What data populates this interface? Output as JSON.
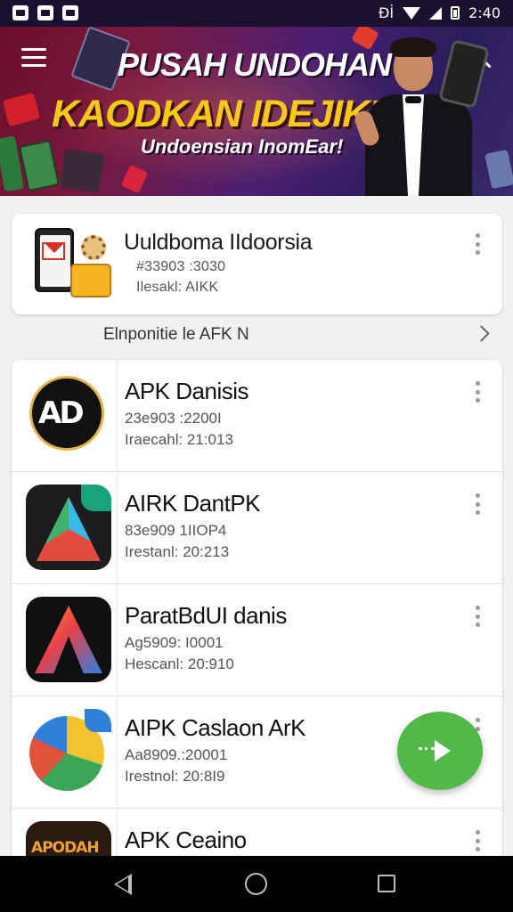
{
  "status_bar": {
    "time": "2:40",
    "left_icons": [
      "notification-icon",
      "notification-icon",
      "notification-icon"
    ],
    "right_icons": [
      "vibrate-icon",
      "wifi-icon",
      "signal-icon",
      "battery-icon"
    ],
    "vibrate_glyph": "Đİ"
  },
  "banner": {
    "line1": "PUSAH UNDOHAN",
    "line2": "KAODKAN IDEJIK'S",
    "line3": "Undoensian InomEar!",
    "colors": {
      "title": "#ffffff",
      "highlight": "#f7c916",
      "background": "#4c1e72"
    }
  },
  "toolbar": {
    "menu_icon": "hamburger-menu-icon",
    "search_icon": "search-icon"
  },
  "featured": {
    "title": "Uuldboma IIdoorsia",
    "line1": "#33903 :3030",
    "line2": "Ilesakl: AIKK"
  },
  "section": {
    "label": "Elnponitie le AFK N",
    "chevron_icon": "chevron-right-icon"
  },
  "apps": [
    {
      "title": "APK Danisis",
      "line1": "23e903 :2200I",
      "line2": "Iraecahl: 21:013",
      "icon": "ad-logo-icon"
    },
    {
      "title": "AIRK DantPK",
      "line1": "83e909 1IIOP4",
      "line2": "Irestanl: 20:213",
      "icon": "a-logo-icon"
    },
    {
      "title": "ParatBdUI danis",
      "line1": "Ag5909: I0001",
      "line2": "Hescanl: 20:910",
      "icon": "a-gradient-logo-icon"
    },
    {
      "title": "AIPK Caslaon ArK",
      "line1": "Aa8909.:20001",
      "line2": "Irestnol: 20:8I9",
      "icon": "a-colorful-logo-icon"
    },
    {
      "title": "APK Ceaino",
      "line1": "",
      "line2": "",
      "icon": "apodah-logo-icon",
      "icon_text": "APODAH"
    }
  ],
  "fab": {
    "icon": "send-icon",
    "color": "#52b848"
  },
  "nav": {
    "back_icon": "back-icon",
    "home_icon": "home-icon",
    "recents_icon": "recents-icon"
  }
}
